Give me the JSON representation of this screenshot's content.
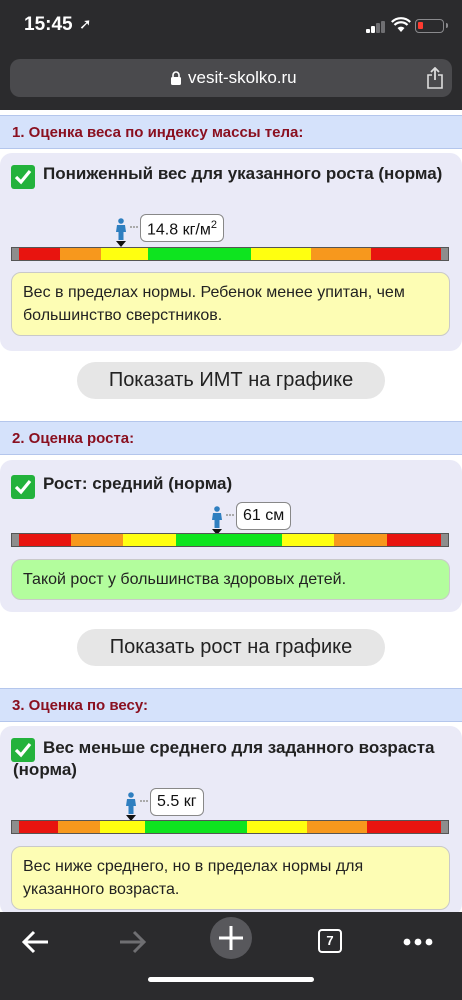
{
  "status": {
    "time": "15:45"
  },
  "browser": {
    "url": "vesit-skolko.ru",
    "tab_count": "7"
  },
  "sections": [
    {
      "header": "1. Оценка веса по индексу массы тела:",
      "title": "Пониженный вес для указанного роста (норма)",
      "value": "14.8 кг/м",
      "value_sup": "2",
      "note": "Вес в пределах нормы. Ребенок менее упитан, чем большинство сверстников.",
      "note_color": "yellow",
      "button": "Показать ИМТ на графике"
    },
    {
      "header": "2. Оценка роста:",
      "title": "Рост: средний (норма)",
      "value": "61 см",
      "note": "Такой рост у большинства здоровых детей.",
      "note_color": "green",
      "button": "Показать рост на графике"
    },
    {
      "header": "3. Оценка по весу:",
      "title": "Вес меньше среднего для заданного возраста (норма)",
      "value": "5.5 кг",
      "note": "Вес ниже среднего, но в пределах нормы для указанного возраста.",
      "note_color": "yellow"
    }
  ],
  "colors": {
    "header_text": "#8a1020",
    "header_bg": "#d5e2fb",
    "scale": [
      "#e8140f",
      "#f7981d",
      "#ffff10",
      "#0ee41f"
    ]
  }
}
